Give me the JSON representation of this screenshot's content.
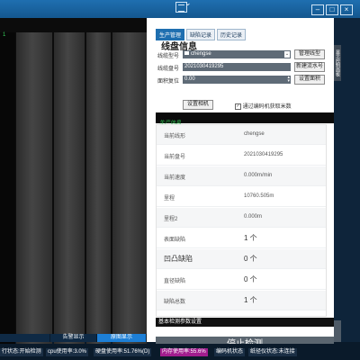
{
  "window": {
    "controls": [
      "–",
      "□",
      "×"
    ]
  },
  "viewer": {
    "green_marker": "1",
    "tabs": [
      "",
      "告警显示",
      "原图显示"
    ]
  },
  "panel": {
    "tabs": [
      "生产管理",
      "缺陷记录",
      "历史记录"
    ],
    "active_tab_index": 0,
    "section_title": "线盘信息",
    "fields": {
      "type_label": "线缆型号",
      "type_value": "chengse",
      "type_button": "管理线型",
      "reel_label": "线缆盘号",
      "reel_value": "2021030419295",
      "reel_button": "新建流水号",
      "reset_label": "面积复位",
      "reset_value": "0.00",
      "reset_button": "设置面积"
    },
    "camera_button": "设置相机",
    "checkbox_label": "通过编码机获取米数",
    "checkbox_checked": true,
    "production_label": "生产信息",
    "info_rows": [
      {
        "key": "当前线形",
        "value": "chengse"
      },
      {
        "key": "当前盘号",
        "value": "2021030419295"
      },
      {
        "key": "当前速度",
        "value": "0.000m/min"
      },
      {
        "key": "里程",
        "value": "10760.505m"
      },
      {
        "key": "里程2",
        "value": "0.000m"
      },
      {
        "key": "表面缺陷",
        "value": "1 个"
      },
      {
        "key": "凹凸缺陷",
        "value": "0 个"
      },
      {
        "key": "直径缺陷",
        "value": "0 个"
      },
      {
        "key": "缺陷总数",
        "value": "1 个"
      }
    ],
    "basic_settings_label": "基本检测参数设置",
    "stop_button": "停止检测"
  },
  "right_strip": {
    "side_tab_label": "显示控制面板"
  },
  "status_bar": [
    {
      "text": "行状态:开始检测"
    },
    {
      "text": "cpu使用率:3.0%"
    },
    {
      "text": "硬盘使用率:51.76%(D)"
    },
    {
      "text": "内存使用率:55.6%",
      "highlight": true
    },
    {
      "text": "编码机状态"
    },
    {
      "text": "纸径仪状态:未连接"
    }
  ],
  "colors": {
    "titlebar": "#1f6fb0",
    "accent_blue": "#1d7fd6",
    "production_green": "#2dbb4f",
    "memory_highlight": "#a11d8e",
    "stop_button": "#5b6670"
  }
}
